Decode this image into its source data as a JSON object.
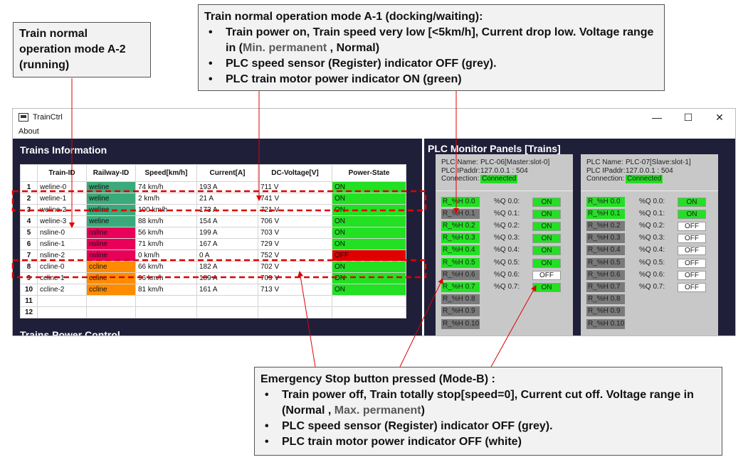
{
  "notes": {
    "a2": {
      "line1": "Train normal",
      "line2": "operation mode A-2",
      "line3": "(running)"
    },
    "a1": {
      "title": "Train normal operation mode A-1 (docking/waiting):",
      "b1a": "Train power on, Train speed very low [<5km/h],  Current drop low. Voltage range in (",
      "b1b": "Min. permanent",
      "b1c": " , Normal)",
      "b2": "PLC speed sensor (Register) indicator OFF (grey).",
      "b3": "PLC train motor power indicator ON (green)"
    },
    "b": {
      "title": "Emergency Stop button pressed (Mode-B) :",
      "b1a": "Train power off, Train totally stop[speed=0], Current cut off. Voltage range in (Normal , ",
      "b1b": "Max. permanent",
      "b1c": ")",
      "b2": "PLC speed sensor (Register) indicator OFF (grey).",
      "b3": "PLC train motor power indicator OFF (white)"
    }
  },
  "window": {
    "title": "TrainCtrl",
    "menu": "About",
    "minimize": "—",
    "maximize": "☐",
    "close": "✕"
  },
  "trains": {
    "heading": "Trains Information",
    "power_control": "Trains Power Control",
    "columns": [
      "Train-ID",
      "Railway-ID",
      "Speed[km/h]",
      "Current[A]",
      "DC-Voltage[V]",
      "Power-State"
    ],
    "rows": [
      {
        "n": "1",
        "id": "weline-0",
        "rail": "weline",
        "speed": "74 km/h",
        "cur": "193 A",
        "volt": "711 V",
        "power": "ON",
        "rc": "#3aaa7a",
        "pc": "#22e022"
      },
      {
        "n": "2",
        "id": "weline-1",
        "rail": "weline",
        "speed": "2 km/h",
        "cur": "21 A",
        "volt": "741 V",
        "power": "ON",
        "rc": "#3aaa7a",
        "pc": "#22e022"
      },
      {
        "n": "3",
        "id": "weline-2",
        "rail": "weline",
        "speed": "100 km/h",
        "cur": "173 A",
        "volt": "721 V",
        "power": "ON",
        "rc": "#3aaa7a",
        "pc": "#22e022"
      },
      {
        "n": "4",
        "id": "weline-3",
        "rail": "weline",
        "speed": "88 km/h",
        "cur": "154 A",
        "volt": "706 V",
        "power": "ON",
        "rc": "#3aaa7a",
        "pc": "#22e022"
      },
      {
        "n": "5",
        "id": "nsline-0",
        "rail": "nsline",
        "speed": "56 km/h",
        "cur": "199 A",
        "volt": "703 V",
        "power": "ON",
        "rc": "#e8005a",
        "pc": "#22e022"
      },
      {
        "n": "6",
        "id": "nsline-1",
        "rail": "nsline",
        "speed": "71 km/h",
        "cur": "167 A",
        "volt": "729 V",
        "power": "ON",
        "rc": "#e8005a",
        "pc": "#22e022"
      },
      {
        "n": "7",
        "id": "nsline-2",
        "rail": "nsline",
        "speed": "0 km/h",
        "cur": "0 A",
        "volt": "752 V",
        "power": "OFF",
        "rc": "#e8005a",
        "pc": "#e00000"
      },
      {
        "n": "8",
        "id": "ccline-0",
        "rail": "ccline",
        "speed": "66 km/h",
        "cur": "182 A",
        "volt": "702 V",
        "power": "ON",
        "rc": "#ff8c00",
        "pc": "#22e022"
      },
      {
        "n": "9",
        "id": "ccline-1",
        "rail": "ccline",
        "speed": "96 km/h",
        "cur": "189 A",
        "volt": "709 V",
        "power": "ON",
        "rc": "#ff8c00",
        "pc": "#22e022"
      },
      {
        "n": "10",
        "id": "ccline-2",
        "rail": "ccline",
        "speed": "81 km/h",
        "cur": "161 A",
        "volt": "713 V",
        "power": "ON",
        "rc": "#ff8c00",
        "pc": "#22e022"
      },
      {
        "n": "11",
        "id": "",
        "rail": "",
        "speed": "",
        "cur": "",
        "volt": "",
        "power": "",
        "rc": "",
        "pc": ""
      },
      {
        "n": "12",
        "id": "",
        "rail": "",
        "speed": "",
        "cur": "",
        "volt": "",
        "power": "",
        "rc": "",
        "pc": ""
      }
    ]
  },
  "plc": {
    "heading": "PLC Monitor Panels [Trains]",
    "labels": {
      "name": "PLC Name:",
      "ip": "PLC IPaddr:",
      "conn": "Connection:"
    },
    "panels": [
      {
        "name": "PLC-06[Master:slot-0]",
        "ip": "127.0.0.1 : 504",
        "conn": "Connected",
        "regs": [
          {
            "l": "R_%H 0.0",
            "s": "on"
          },
          {
            "l": "R_%H 0.1",
            "s": "offg"
          },
          {
            "l": "R_%H 0.2",
            "s": "on"
          },
          {
            "l": "R_%H 0.3",
            "s": "on"
          },
          {
            "l": "R_%H 0.4",
            "s": "on"
          },
          {
            "l": "R_%H 0.5",
            "s": "on"
          },
          {
            "l": "R_%H 0.6",
            "s": "offg"
          },
          {
            "l": "R_%H 0.7",
            "s": "on"
          },
          {
            "l": "R_%H 0.8",
            "s": "offg"
          },
          {
            "l": "R_%H 0.9",
            "s": "offg"
          },
          {
            "l": "R_%H 0.10",
            "s": "offg"
          }
        ],
        "qs": [
          {
            "l": "%Q 0.0:",
            "v": "ON",
            "s": "on"
          },
          {
            "l": "%Q 0.1:",
            "v": "ON",
            "s": "on"
          },
          {
            "l": "%Q 0.2:",
            "v": "ON",
            "s": "on"
          },
          {
            "l": "%Q 0.3:",
            "v": "ON",
            "s": "on"
          },
          {
            "l": "%Q 0.4:",
            "v": "ON",
            "s": "on"
          },
          {
            "l": "%Q 0.5:",
            "v": "ON",
            "s": "on"
          },
          {
            "l": "%Q 0.6:",
            "v": "OFF",
            "s": "offw"
          },
          {
            "l": "%Q 0.7:",
            "v": "ON",
            "s": "on"
          }
        ]
      },
      {
        "name": "PLC-07[Slave:slot-1]",
        "ip": "127.0.0.1 : 504",
        "conn": "Connected",
        "regs": [
          {
            "l": "R_%H 0.0",
            "s": "on"
          },
          {
            "l": "R_%H 0.1",
            "s": "on"
          },
          {
            "l": "R_%H 0.2",
            "s": "offg"
          },
          {
            "l": "R_%H 0.3",
            "s": "offg"
          },
          {
            "l": "R_%H 0.4",
            "s": "offg"
          },
          {
            "l": "R_%H 0.5",
            "s": "offg"
          },
          {
            "l": "R_%H 0.6",
            "s": "offg"
          },
          {
            "l": "R_%H 0.7",
            "s": "offg"
          },
          {
            "l": "R_%H 0.8",
            "s": "offg"
          },
          {
            "l": "R_%H 0.9",
            "s": "offg"
          },
          {
            "l": "R_%H 0.10",
            "s": "offg"
          }
        ],
        "qs": [
          {
            "l": "%Q 0.0:",
            "v": "ON",
            "s": "on"
          },
          {
            "l": "%Q 0.1:",
            "v": "ON",
            "s": "on"
          },
          {
            "l": "%Q 0.2:",
            "v": "OFF",
            "s": "offw"
          },
          {
            "l": "%Q 0.3:",
            "v": "OFF",
            "s": "offw"
          },
          {
            "l": "%Q 0.4:",
            "v": "OFF",
            "s": "offw"
          },
          {
            "l": "%Q 0.5:",
            "v": "OFF",
            "s": "offw"
          },
          {
            "l": "%Q 0.6:",
            "v": "OFF",
            "s": "offw"
          },
          {
            "l": "%Q 0.7:",
            "v": "OFF",
            "s": "offw"
          }
        ]
      }
    ]
  },
  "colors": {
    "annotation": "#e00000",
    "panel_bg": "#1f1f3a"
  }
}
